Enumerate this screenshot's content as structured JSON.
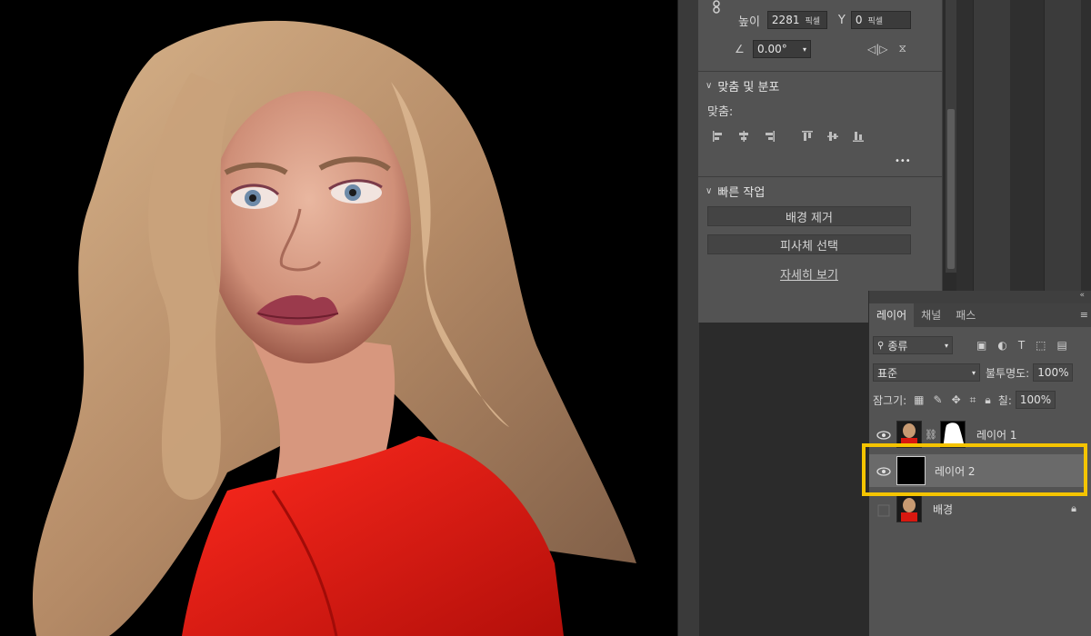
{
  "properties": {
    "height_label": "높이",
    "height_value": "2281",
    "height_unit": "픽셀",
    "y_label": "Y",
    "y_value": "0",
    "y_unit": "픽셀",
    "angle_value": "0.00°",
    "align_section_title": "맞춤 및 분포",
    "align_label": "맞춤:",
    "more_label": "•••",
    "quick_actions_title": "빠른 작업",
    "remove_bg_label": "배경 제거",
    "select_subject_label": "피사체 선택",
    "learn_more_label": "자세히 보기"
  },
  "layers_panel": {
    "tabs": [
      "레이어",
      "채널",
      "패스"
    ],
    "filter_label": "종류",
    "blend_mode": "표준",
    "opacity_label": "불투명도:",
    "opacity_value": "100%",
    "lock_label": "잠그기:",
    "fill_label": "칠:",
    "fill_value": "100%",
    "layers": [
      {
        "name": "레이어 1",
        "visible": true
      },
      {
        "name": "레이어 2",
        "visible": true,
        "selected": true
      },
      {
        "name": "배경",
        "visible": false,
        "locked": true
      }
    ]
  },
  "colors": {
    "highlight": "#f5c400",
    "panel_bg": "#535353",
    "canvas_bg": "#000000",
    "sweater_red": "#e3150f"
  }
}
